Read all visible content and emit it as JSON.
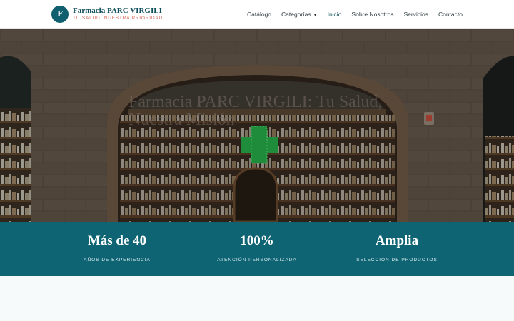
{
  "brand": {
    "logo_letter": "F",
    "name": "Farmacia PARC VIRGILI",
    "tagline": "Tu salud, nuestra prioridad"
  },
  "nav": {
    "items": [
      {
        "label": "Catálogo"
      },
      {
        "label": "Categorías"
      },
      {
        "label": "Inicio"
      },
      {
        "label": "Sobre Nosotros"
      },
      {
        "label": "Servicios"
      },
      {
        "label": "Contacto"
      }
    ],
    "active": "Inicio",
    "dropdown_caret": "▼"
  },
  "hero": {
    "title": "Farmacia PARC VIRGILI: Tu Salud, Nuestra Misión"
  },
  "stats": [
    {
      "value": "Más de 40",
      "label": "Años de experiencia"
    },
    {
      "value": "100%",
      "label": "Atención personalizada"
    },
    {
      "value": "Amplia",
      "label": "Selección de productos"
    }
  ],
  "colors": {
    "primary": "#0f6474",
    "accent": "#d56a5a",
    "brand_text": "#0f4f5c"
  }
}
